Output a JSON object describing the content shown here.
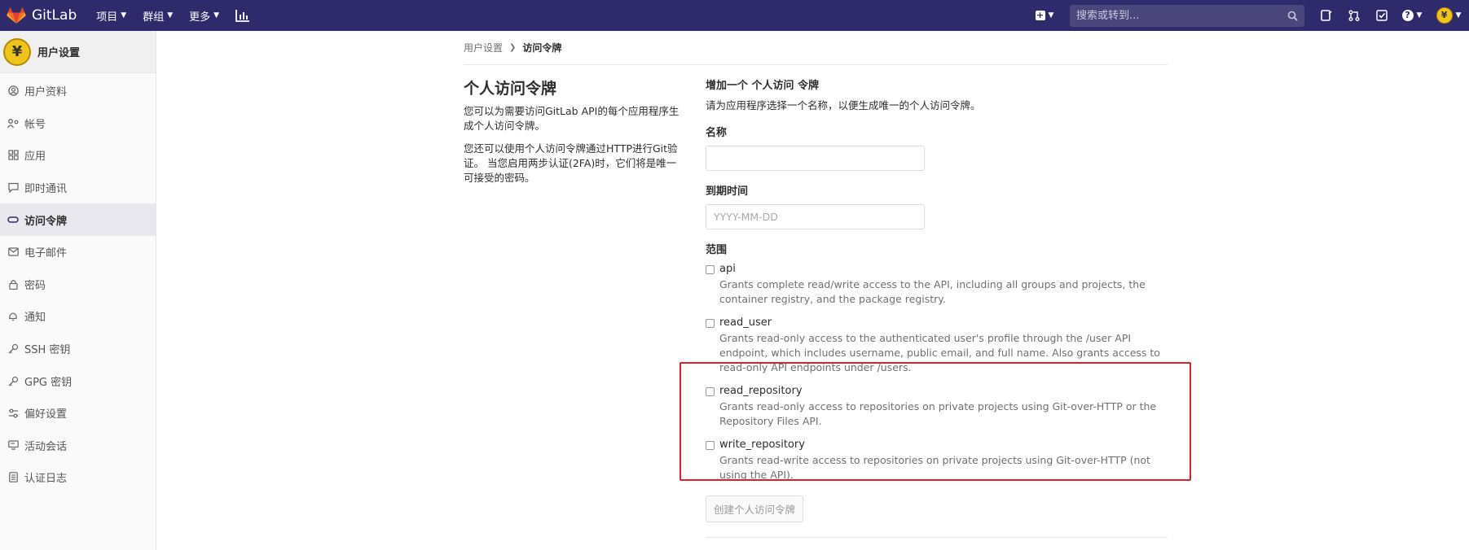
{
  "navbar": {
    "brand": "GitLab",
    "menus": [
      {
        "label": "项目"
      },
      {
        "label": "群组"
      },
      {
        "label": "更多"
      }
    ],
    "search_placeholder": "搜索或转到..."
  },
  "sidebar": {
    "title": "用户设置",
    "avatar_glyph": "¥",
    "items": [
      {
        "label": "用户资料",
        "icon": "user-icon"
      },
      {
        "label": "帐号",
        "icon": "account-icon"
      },
      {
        "label": "应用",
        "icon": "applications-icon"
      },
      {
        "label": "即时通讯",
        "icon": "chat-icon"
      },
      {
        "label": "访问令牌",
        "icon": "token-icon"
      },
      {
        "label": "电子邮件",
        "icon": "email-icon"
      },
      {
        "label": "密码",
        "icon": "lock-icon"
      },
      {
        "label": "通知",
        "icon": "bell-icon"
      },
      {
        "label": "SSH 密钥",
        "icon": "key-icon"
      },
      {
        "label": "GPG 密钥",
        "icon": "key-icon"
      },
      {
        "label": "偏好设置",
        "icon": "preferences-icon"
      },
      {
        "label": "活动会话",
        "icon": "monitor-icon"
      },
      {
        "label": "认证日志",
        "icon": "log-icon"
      }
    ],
    "active_index": 4
  },
  "breadcrumb": {
    "parent": "用户设置",
    "current": "访问令牌"
  },
  "intro": {
    "title": "个人访问令牌",
    "p1": "您可以为需要访问GitLab API的每个应用程序生成个人访问令牌。",
    "p2": "您还可以使用个人访问令牌通过HTTP进行Git验证。 当您启用两步认证(2FA)时，它们将是唯一可接受的密码。"
  },
  "form": {
    "heading": "增加一个 个人访问 令牌",
    "description": "请为应用程序选择一个名称，以便生成唯一的个人访问令牌。",
    "name_label": "名称",
    "name_value": "",
    "expiry_label": "到期时间",
    "expiry_placeholder": "YYYY-MM-DD",
    "scopes_label": "范围",
    "scopes": [
      {
        "name": "api",
        "description": "Grants complete read/write access to the API, including all groups and projects, the container registry, and the package registry.",
        "checked": false
      },
      {
        "name": "read_user",
        "description": "Grants read-only access to the authenticated user's profile through the /user API endpoint, which includes username, public email, and full name. Also grants access to read-only API endpoints under /users.",
        "checked": false
      },
      {
        "name": "read_repository",
        "description": "Grants read-only access to repositories on private projects using Git-over-HTTP or the Repository Files API.",
        "checked": false
      },
      {
        "name": "write_repository",
        "description": "Grants read-write access to repositories on private projects using Git-over-HTTP (not using the API).",
        "checked": false
      }
    ],
    "submit_label": "创建个人访问令牌"
  },
  "colors": {
    "navbar": "#2f2a6b",
    "highlight": "#e0202d"
  }
}
